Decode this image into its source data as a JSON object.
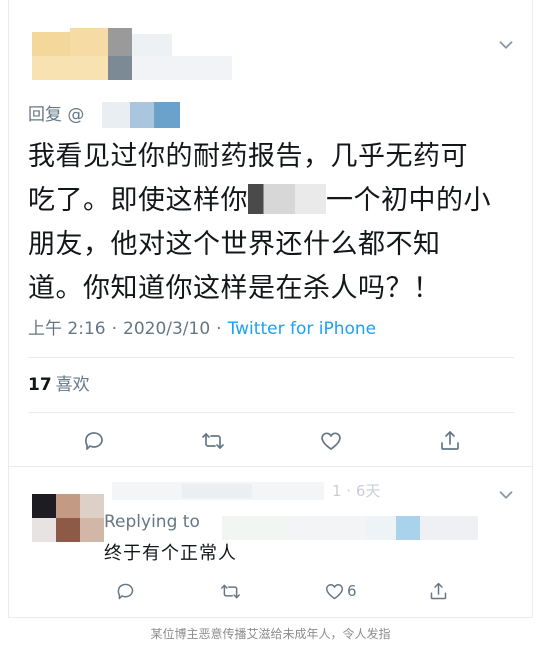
{
  "main_tweet": {
    "reply_to_label": "回复 @",
    "text_lines": [
      "我看见过你的耐药报告，几乎无药可",
      "吃了。即使这样你",
      "一个初中的小",
      "朋友，他对这个世界还什么都不知",
      "道。你知道你这样是在杀人吗？！"
    ],
    "time": "上午 2:16",
    "date": "2020/3/10",
    "separator": "·",
    "source": "Twitter for iPhone",
    "likes_count": "17",
    "likes_label": "喜欢",
    "actions": [
      "reply-icon",
      "retweet-icon",
      "like-icon",
      "share-icon"
    ]
  },
  "reply_tweet": {
    "replying_label": "Replying to",
    "partial_time": "1 · 6天",
    "text": "终于有个正常人",
    "like_count": "6",
    "actions": [
      "reply-icon",
      "retweet-icon",
      "like-icon",
      "share-icon"
    ]
  },
  "caption": "某位博主恶意传播艾滋给未成年人，令人发指",
  "colors": {
    "text": "#14171a",
    "muted": "#657786",
    "link": "#1da1f2",
    "divider": "#e6ecf0",
    "caption": "#8c8c8c"
  }
}
